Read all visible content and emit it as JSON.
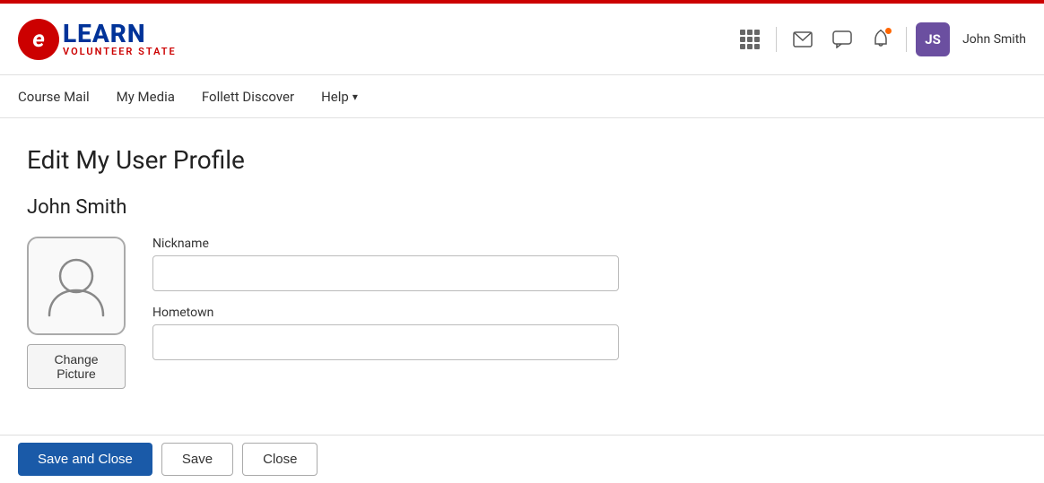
{
  "topbar": {},
  "header": {
    "logo_e": "e",
    "logo_learn": "LEARN",
    "logo_subtitle": "VOLUNTEER STATE",
    "user_initials": "JS",
    "user_name": "John Smith"
  },
  "nav": {
    "items": [
      {
        "label": "Course Mail"
      },
      {
        "label": "My Media"
      },
      {
        "label": "Follett Discover"
      },
      {
        "label": "Help"
      }
    ]
  },
  "main": {
    "page_title": "Edit My User Profile",
    "user_full_name": "John Smith",
    "avatar_alt": "User profile picture placeholder",
    "change_picture_label": "Change Picture",
    "form": {
      "nickname_label": "Nickname",
      "nickname_value": "",
      "nickname_placeholder": "",
      "hometown_label": "Hometown",
      "hometown_value": "",
      "hometown_placeholder": ""
    }
  },
  "bottom_bar": {
    "save_close_label": "Save and Close",
    "save_label": "Save",
    "close_label": "Close"
  }
}
